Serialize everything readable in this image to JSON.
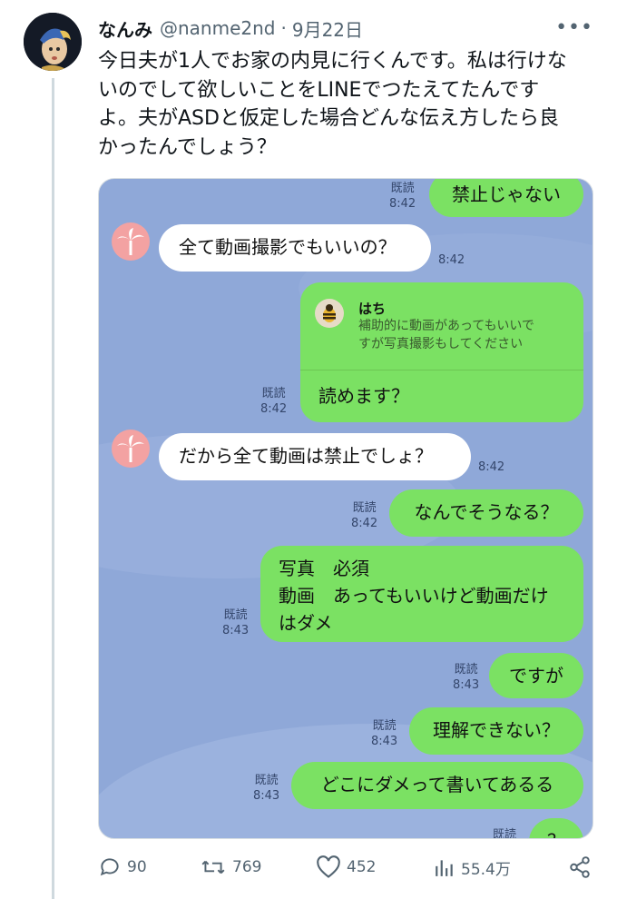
{
  "tweet": {
    "display_name": "なんみ",
    "handle": "@nanme2nd",
    "separator": "·",
    "date": "9月22日",
    "more": "•••",
    "text_lines": [
      "今日夫が1人でお家の内見に行くんです。私は行けな",
      "いのでして欲しいことをLINEでつたえてたんです",
      "よ。夫がASDと仮定した場合どんな伝え方したら良",
      "かったんでしょう？"
    ]
  },
  "chat": {
    "messages": [
      {
        "id": "m1",
        "side": "right",
        "text": "禁止じゃない",
        "read": "既読",
        "time": "8:42"
      },
      {
        "id": "m2",
        "side": "left",
        "text": "全て動画撮影でもいいの？",
        "time": "8:42"
      },
      {
        "id": "m3",
        "side": "right",
        "quote_name": "はち",
        "quote_lines": [
          "補助的に動画があってもいいで",
          "すが写真撮影もしてください"
        ],
        "text": "読めます？",
        "read": "既読",
        "time": "8:42"
      },
      {
        "id": "m4",
        "side": "left",
        "text": "だから全て動画は禁止でしょ？",
        "time": "8:42"
      },
      {
        "id": "m5",
        "side": "right",
        "text": "なんでそうなる？",
        "read": "既読",
        "time": "8:42"
      },
      {
        "id": "m6",
        "side": "right",
        "lines": [
          "写真　必須",
          "動画　あってもいいけど動画だけ",
          "はダメ"
        ],
        "read": "既読",
        "time": "8:43"
      },
      {
        "id": "m7",
        "side": "right",
        "text": "ですが",
        "read": "既読",
        "time": "8:43"
      },
      {
        "id": "m8",
        "side": "right",
        "text": "理解できない？",
        "read": "既読",
        "time": "8:43"
      },
      {
        "id": "m9",
        "side": "right",
        "text": "どこにダメって書いてあるる",
        "read": "既読",
        "time": "8:43"
      },
      {
        "id": "m10",
        "side": "right",
        "text": "？",
        "read": "既読",
        "time": ""
      }
    ]
  },
  "actions": {
    "replies": "90",
    "retweets": "769",
    "likes": "452",
    "views": "55.4万"
  },
  "colors": {
    "chat_bg": "#8fa8d8",
    "green_bubble": "#7be163",
    "muted": "#536471"
  },
  "icons": [
    "reply-icon",
    "retweet-icon",
    "like-icon",
    "views-icon",
    "share-icon",
    "palm-tree-icon",
    "bee-icon",
    "more-icon"
  ]
}
